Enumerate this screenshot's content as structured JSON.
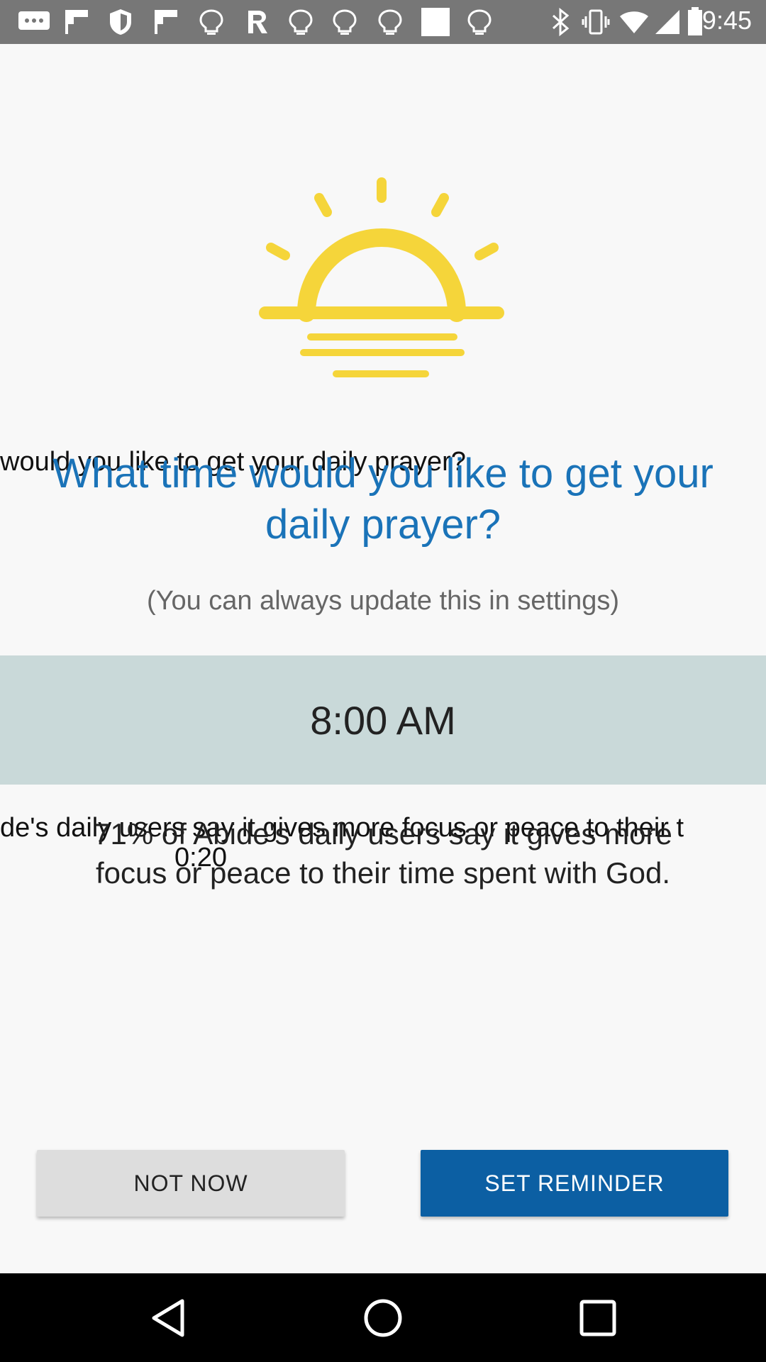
{
  "status_bar": {
    "time": "9:45",
    "icons": [
      "chat-icon",
      "flipboard-icon",
      "shield-icon",
      "flipboard-icon",
      "bulb-icon",
      "r-icon",
      "bulb-icon",
      "bulb-icon",
      "bulb-icon",
      "square-icon",
      "bulb-icon",
      "bluetooth-icon",
      "vibrate-icon",
      "wifi-icon",
      "signal-icon",
      "battery-icon"
    ]
  },
  "overlay": {
    "question_left": "would you like to get your daily prayer?",
    "stat_left": "de's daily users say it gives more focus or peace to their t",
    "timer": "0:20"
  },
  "main": {
    "title": "What time would you like to get your daily prayer?",
    "subtitle": "(You can always update this in settings)",
    "time_value": "8:00 AM",
    "stat_text": "71% of Abide's daily users say it gives more focus or peace to their time spent with God."
  },
  "buttons": {
    "not_now": "NOT NOW",
    "set_reminder": "SET REMINDER"
  },
  "colors": {
    "accent_blue": "#1a73b8",
    "button_blue": "#0c5fa3",
    "sun_yellow": "#f5d53a",
    "time_band": "#c9d9d9"
  }
}
